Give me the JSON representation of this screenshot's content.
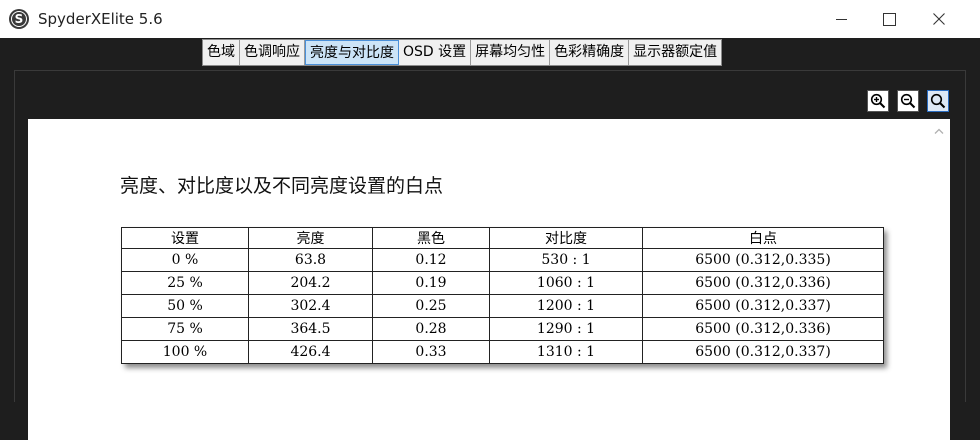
{
  "window": {
    "title": "SpyderXElite 5.6",
    "app_icon_letter": "S"
  },
  "tabs": [
    {
      "label": "色域",
      "active": false
    },
    {
      "label": "色调响应",
      "active": false
    },
    {
      "label": "亮度与对比度",
      "active": true
    },
    {
      "label": "OSD 设置",
      "active": false
    },
    {
      "label": "屏幕均匀性",
      "active": false
    },
    {
      "label": "色彩精确度",
      "active": false
    },
    {
      "label": "显示器额定值",
      "active": false
    }
  ],
  "report": {
    "title": "亮度、对比度以及不同亮度设置的白点",
    "columns": [
      "设置",
      "亮度",
      "黑色",
      "对比度",
      "白点"
    ],
    "rows": [
      [
        "0 %",
        "63.8",
        "0.12",
        "530 : 1",
        "6500 (0.312,0.335)"
      ],
      [
        "25 %",
        "204.2",
        "0.19",
        "1060 : 1",
        "6500 (0.312,0.336)"
      ],
      [
        "50 %",
        "302.4",
        "0.25",
        "1200 : 1",
        "6500 (0.312,0.337)"
      ],
      [
        "75 %",
        "364.5",
        "0.28",
        "1290 : 1",
        "6500 (0.312,0.336)"
      ],
      [
        "100 %",
        "426.4",
        "0.33",
        "1310 : 1",
        "6500 (0.312,0.337)"
      ]
    ]
  },
  "icons": {
    "zoom_in": "zoom-in-icon",
    "zoom_out": "zoom-out-icon",
    "zoom_fit": "zoom-fit-icon"
  },
  "colors": {
    "frame": "#1e1e1e",
    "active_tab": "#cce4f7",
    "active_tab_border": "#4a90d9"
  }
}
